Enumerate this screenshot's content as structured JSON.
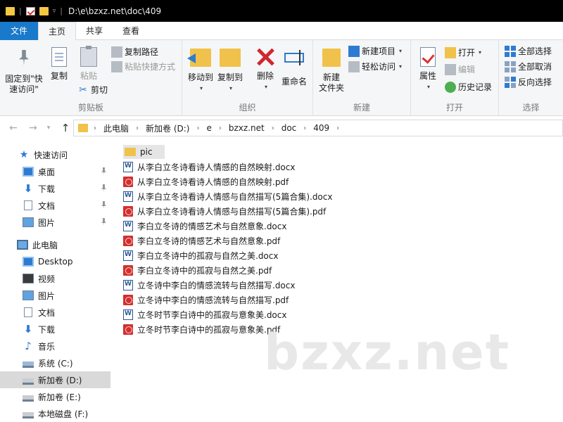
{
  "window": {
    "path": "D:\\e\\bzxz.net\\doc\\409"
  },
  "tabs": [
    "文件",
    "主页",
    "共享",
    "查看"
  ],
  "ribbon": {
    "clipboard": {
      "pin_label_1": "固定到\"快",
      "pin_label_2": "速访问\"",
      "copy": "复制",
      "paste": "粘贴",
      "copy_path": "复制路径",
      "paste_shortcut": "粘贴快捷方式",
      "cut": "剪切",
      "group": "剪贴板"
    },
    "organize": {
      "move_to": "移动到",
      "copy_to": "复制到",
      "delete": "删除",
      "rename": "重命名",
      "group": "组织"
    },
    "new": {
      "new_folder_1": "新建",
      "new_folder_2": "文件夹",
      "new_item": "新建项目",
      "easy_access": "轻松访问",
      "group": "新建"
    },
    "open": {
      "properties": "属性",
      "open": "打开",
      "edit": "编辑",
      "history": "历史记录",
      "group": "打开"
    },
    "select": {
      "select_all": "全部选择",
      "select_none": "全部取消",
      "invert": "反向选择",
      "group": "选择"
    }
  },
  "breadcrumb": [
    "此电脑",
    "新加卷 (D:)",
    "e",
    "bzxz.net",
    "doc",
    "409"
  ],
  "sidebar": {
    "items": [
      {
        "label": "快速访问",
        "icon": "star-icon"
      },
      {
        "label": "桌面",
        "icon": "desktop-icon"
      },
      {
        "label": "下载",
        "icon": "download-icon"
      },
      {
        "label": "文档",
        "icon": "document-icon"
      },
      {
        "label": "图片",
        "icon": "pictures-icon"
      },
      {
        "label": "此电脑",
        "icon": "computer-icon"
      },
      {
        "label": "Desktop",
        "icon": "desktop-icon"
      },
      {
        "label": "视频",
        "icon": "video-icon"
      },
      {
        "label": "图片",
        "icon": "pictures-icon"
      },
      {
        "label": "文档",
        "icon": "document-icon"
      },
      {
        "label": "下载",
        "icon": "download-icon"
      },
      {
        "label": "音乐",
        "icon": "music-icon"
      },
      {
        "label": "系统 (C:)",
        "icon": "drive-icon"
      },
      {
        "label": "新加卷 (D:)",
        "icon": "drive-icon"
      },
      {
        "label": "新加卷 (E:)",
        "icon": "drive-icon"
      },
      {
        "label": "本地磁盘 (F:)",
        "icon": "drive-icon"
      }
    ]
  },
  "files": [
    {
      "name": "pic",
      "type": "folder"
    },
    {
      "name": "从李白立冬诗看诗人情感的自然映射.docx",
      "type": "docx"
    },
    {
      "name": "从李白立冬诗看诗人情感的自然映射.pdf",
      "type": "pdf"
    },
    {
      "name": "从李白立冬诗看诗人情感与自然描写(5篇合集).docx",
      "type": "docx"
    },
    {
      "name": "从李白立冬诗看诗人情感与自然描写(5篇合集).pdf",
      "type": "pdf"
    },
    {
      "name": "李白立冬诗的情感艺术与自然意象.docx",
      "type": "docx"
    },
    {
      "name": "李白立冬诗的情感艺术与自然意象.pdf",
      "type": "pdf"
    },
    {
      "name": "李白立冬诗中的孤寂与自然之美.docx",
      "type": "docx"
    },
    {
      "name": "李白立冬诗中的孤寂与自然之美.pdf",
      "type": "pdf"
    },
    {
      "name": "立冬诗中李白的情感流转与自然描写.docx",
      "type": "docx"
    },
    {
      "name": "立冬诗中李白的情感流转与自然描写.pdf",
      "type": "pdf"
    },
    {
      "name": "立冬时节李白诗中的孤寂与意象美.docx",
      "type": "docx"
    },
    {
      "name": "立冬时节李白诗中的孤寂与意象美.pdf",
      "type": "pdf"
    }
  ],
  "watermark": "bzxz.net",
  "colors": {
    "accent": "#1979ca",
    "selected": "#cce8ff",
    "folder": "#f0c24b"
  }
}
